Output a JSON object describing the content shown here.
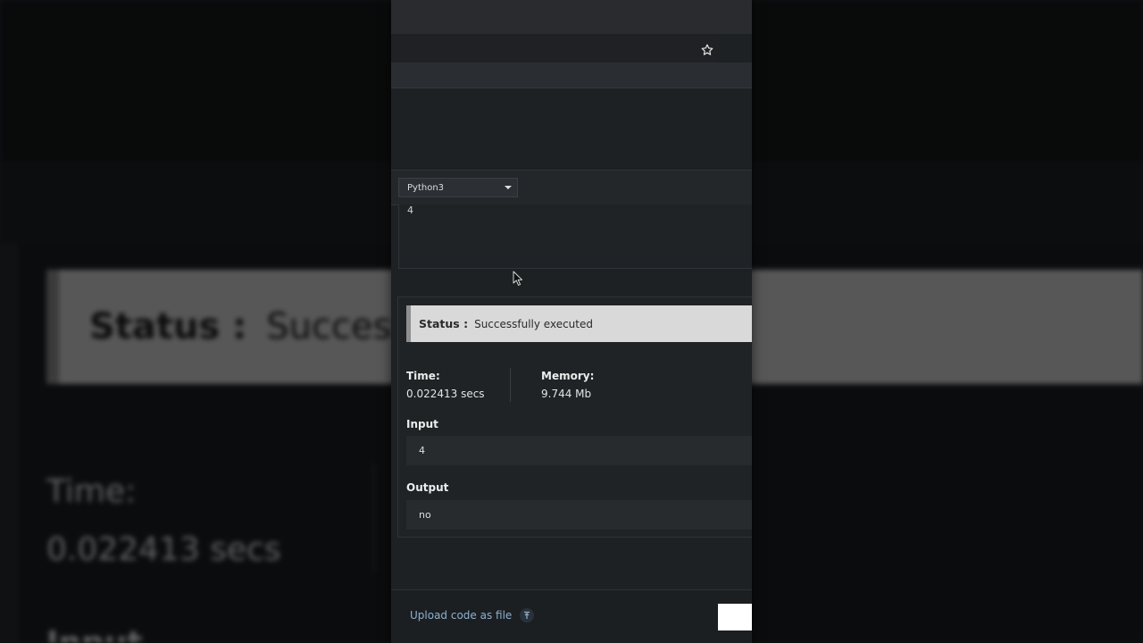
{
  "language_select": {
    "value": "Python3"
  },
  "stdin": {
    "visible_text": "4"
  },
  "result": {
    "status_label": "Status :",
    "status_value": "Successfully executed",
    "time_label": "Time:",
    "time_value": "0.022413 secs",
    "memory_label": "Memory:",
    "memory_value": "9.744 Mb",
    "input_label": "Input",
    "input_value": "4",
    "output_label": "Output",
    "output_value": "no"
  },
  "background_copy": {
    "status_label": "Status :",
    "status_value_partial": "Successf",
    "time_label": "Time:",
    "time_value": "0.022413 secs",
    "input_label": "Input"
  },
  "footer": {
    "upload_label": "Upload code as file"
  },
  "icons": {
    "bookmark": "star-icon",
    "upload": "upload-icon",
    "dropdown": "chevron-down-icon",
    "pointer": "cursor-icon"
  },
  "colors": {
    "page_background": "#1d2124",
    "status_box": "#d9d9d9",
    "status_accent": "#8f8f8f",
    "link": "#8fb0cf"
  }
}
